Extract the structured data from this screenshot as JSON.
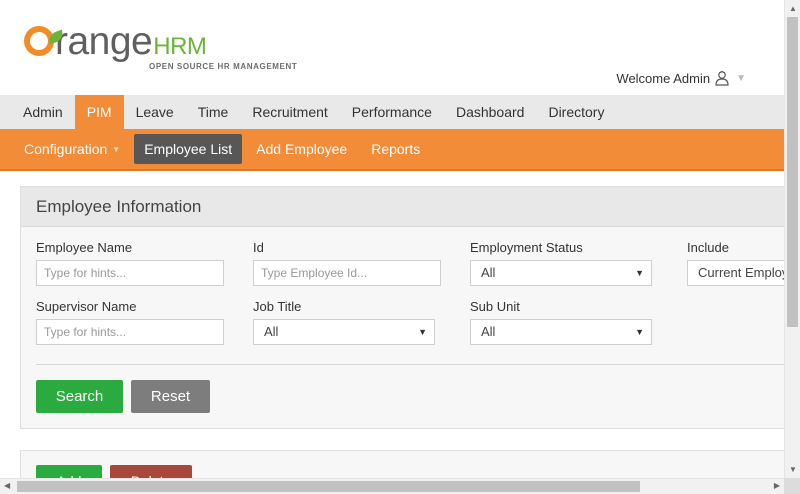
{
  "brand": {
    "logo_word": "range",
    "logo_hrm": "HRM",
    "tagline": "OPEN SOURCE HR MANAGEMENT",
    "orange_color": "#f28c28",
    "green_color": "#6cb33e"
  },
  "header": {
    "welcome": "Welcome Admin",
    "user_icon": "user-icon"
  },
  "main_nav": {
    "items": [
      {
        "label": "Admin"
      },
      {
        "label": "PIM",
        "active": true
      },
      {
        "label": "Leave"
      },
      {
        "label": "Time"
      },
      {
        "label": "Recruitment"
      },
      {
        "label": "Performance"
      },
      {
        "label": "Dashboard"
      },
      {
        "label": "Directory"
      }
    ]
  },
  "sub_nav": {
    "items": [
      {
        "label": "Configuration"
      },
      {
        "label": "Employee List",
        "selected": true
      },
      {
        "label": "Add Employee"
      },
      {
        "label": "Reports"
      }
    ]
  },
  "panel": {
    "title": "Employee Information",
    "fields": {
      "employee_name": {
        "label": "Employee Name",
        "placeholder": "Type for hints..."
      },
      "id": {
        "label": "Id",
        "placeholder": "Type Employee Id..."
      },
      "employment_status": {
        "label": "Employment Status",
        "value": "All"
      },
      "include": {
        "label": "Include",
        "value": "Current Employees Only"
      },
      "supervisor_name": {
        "label": "Supervisor Name",
        "placeholder": "Type for hints..."
      },
      "job_title": {
        "label": "Job Title",
        "value": "All"
      },
      "sub_unit": {
        "label": "Sub Unit",
        "value": "All"
      }
    },
    "buttons": {
      "search": "Search",
      "reset": "Reset"
    }
  },
  "list_actions": {
    "add": "Add",
    "delete": "Delete"
  },
  "colors": {
    "accent": "#f28c38",
    "search_button": "#2bab3f",
    "reset_button": "#7d7d7d",
    "delete_button": "#a8473c",
    "selected_subnav": "#575757"
  }
}
